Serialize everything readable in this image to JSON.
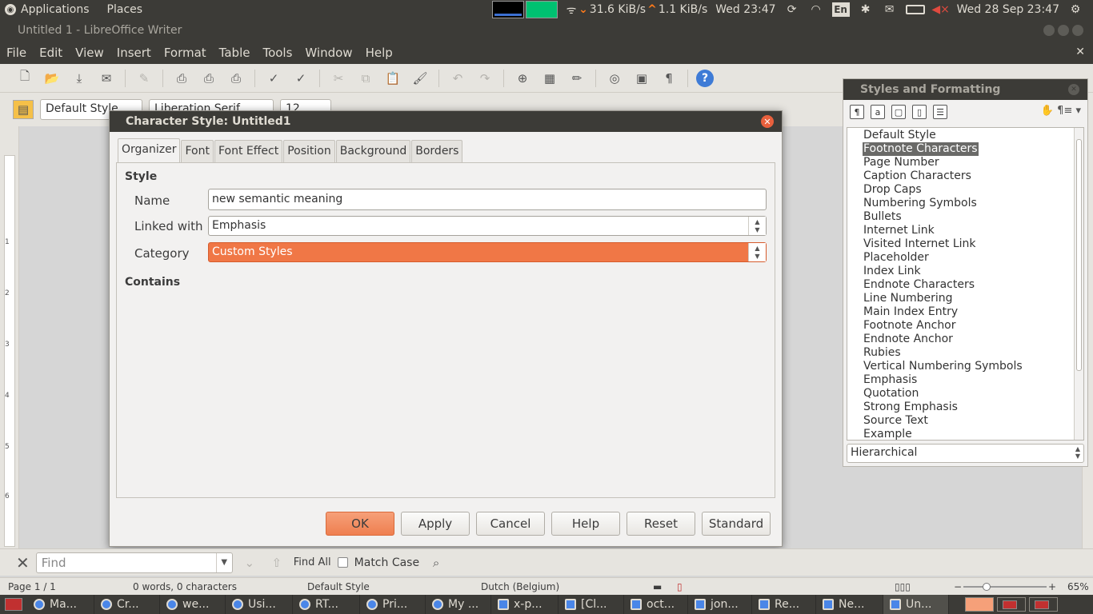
{
  "top_panel": {
    "applications": "Applications",
    "places": "Places",
    "net_down": "31.6 KiB/s",
    "net_up": "1.1 KiB/s",
    "clock_short": "Wed 23:47",
    "keyboard": "En",
    "clock_full": "Wed 28 Sep 23:47"
  },
  "window": {
    "title": "Untitled 1 - LibreOffice Writer"
  },
  "menu": {
    "file": "File",
    "edit": "Edit",
    "view": "View",
    "insert": "Insert",
    "format": "Format",
    "table": "Table",
    "tools": "Tools",
    "window": "Window",
    "help": "Help"
  },
  "toolbar2": {
    "para_style": "Default Style",
    "font_name": "Liberation Serif",
    "font_size": "12"
  },
  "dialog": {
    "title": "Character Style: Untitled1",
    "tabs": [
      "Organizer",
      "Font",
      "Font Effect",
      "Position",
      "Background",
      "Borders"
    ],
    "style_section": "Style",
    "name_label": "Name",
    "name_value": "new semantic meaning",
    "linked_label": "Linked with",
    "linked_value": "Emphasis",
    "category_label": "Category",
    "category_value": "Custom Styles",
    "contains_label": "Contains",
    "buttons": {
      "ok": "OK",
      "apply": "Apply",
      "cancel": "Cancel",
      "help": "Help",
      "reset": "Reset",
      "standard": "Standard"
    }
  },
  "sidebar": {
    "title": "Styles and Formatting",
    "styles": [
      "Default Style",
      "Footnote Characters",
      "Page Number",
      "Caption Characters",
      "Drop Caps",
      "Numbering Symbols",
      "Bullets",
      "Internet Link",
      "Visited Internet Link",
      "Placeholder",
      "Index Link",
      "Endnote Characters",
      "Line Numbering",
      "Main Index Entry",
      "Footnote Anchor",
      "Endnote Anchor",
      "Rubies",
      "Vertical Numbering Symbols",
      "Emphasis",
      "Quotation",
      "Strong Emphasis",
      "Source Text",
      "Example"
    ],
    "selected_style": "Footnote Characters",
    "filter": "Hierarchical"
  },
  "findbar": {
    "placeholder": "Find",
    "find_all": "Find All",
    "match_case": "Match Case"
  },
  "statusbar": {
    "page": "Page 1 / 1",
    "words": "0 words, 0 characters",
    "page_style": "Default Style",
    "language": "Dutch (Belgium)",
    "zoom": "65%"
  },
  "taskbar": {
    "tasks": [
      "Ma...",
      "Cr...",
      "we...",
      "Usi...",
      "RT...",
      "Pri...",
      "My ...",
      "x-p...",
      "[Cl...",
      "oct...",
      "jon...",
      "Re...",
      "Ne...",
      "Un..."
    ]
  },
  "ruler_marks": [
    "1",
    "2",
    "3",
    "4",
    "5",
    "6"
  ]
}
